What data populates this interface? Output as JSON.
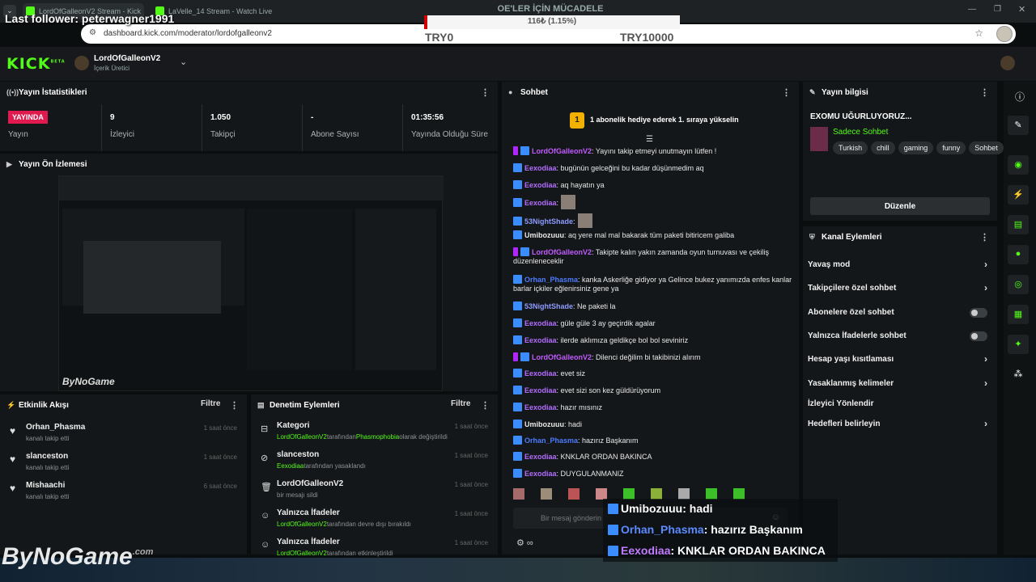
{
  "browser": {
    "tabs": [
      "LordOfGalleonV2 Stream - Kick",
      "LaVelle_14 Stream - Watch Live"
    ],
    "url": "dashboard.kick.com/moderator/lordofgalleonv2"
  },
  "overlay": {
    "last_follower": "Last follower: peterwagner1991",
    "goal_title": "OE'LER İÇİN MÜCADELE",
    "goal_value": "116₺ (1.15%)",
    "goal_progress": 0.0115,
    "goal_min": "TRY0",
    "goal_max": "TRY10000",
    "watermark": "ByNoGame",
    "watermark_suffix": ".com"
  },
  "nav": {
    "logo": "KICK",
    "logo_sup": "BETA",
    "channel_name": "LordOfGalleonV2",
    "channel_role": "İçerik Üretici"
  },
  "stats": {
    "title": "Yayın İstatistikleri",
    "live_badge": "YAYINDA",
    "items": [
      {
        "value": "",
        "label": "Yayın"
      },
      {
        "value": "9",
        "label": "İzleyici"
      },
      {
        "value": "1.050",
        "label": "Takipçi"
      },
      {
        "value": "-",
        "label": "Abone Sayısı"
      },
      {
        "value": "01:35:56",
        "label": "Yayında Olduğu Süre"
      }
    ]
  },
  "preview": {
    "title": "Yayın Ön İzlemesi"
  },
  "activity": {
    "title": "Etkinlik Akışı",
    "filter": "Filtre",
    "events": [
      {
        "name": "Orhan_Phasma",
        "sub": "kanalı takip etti",
        "time": "1 saat önce"
      },
      {
        "name": "slanceston",
        "sub": "kanalı takip etti",
        "time": "1 saat önce"
      },
      {
        "name": "Mishaachi",
        "sub": "kanalı takip etti",
        "time": "6 saat önce"
      }
    ]
  },
  "moderation": {
    "title": "Denetim Eylemleri",
    "filter": "Filtre",
    "actions": [
      {
        "name": "Kategori",
        "actor": "LordOfGalleonV2",
        "middle": "tarafından",
        "target": "Phasmophobia",
        "rest": "olarak değiştirildi",
        "time": "1 saat önce"
      },
      {
        "name": "slanceston",
        "actor": "Eexodiaa",
        "middle": "tarafından yasaklandı",
        "target": "",
        "rest": "",
        "time": "1 saat önce"
      },
      {
        "name": "LordOfGalleonV2",
        "actor": "",
        "middle": "bir mesajı sildi",
        "target": "",
        "rest": "",
        "time": "1 saat önce"
      },
      {
        "name": "Yalnızca İfadeler",
        "actor": "LordOfGalleonV2",
        "middle": "tarafından devre dışı bırakıldı",
        "target": "",
        "rest": "",
        "time": "1 saat önce"
      },
      {
        "name": "Yalnızca İfadeler",
        "actor": "LordOfGalleonV2",
        "middle": "tarafından etkinleştirildi",
        "target": "",
        "rest": "",
        "time": "1 saat önce"
      }
    ]
  },
  "chat": {
    "title": "Sohbet",
    "pinned_rank": "1",
    "pinned": "1 abonelik hediye ederek 1. sıraya yükselin",
    "placeholder": "Bir mesaj gönderin",
    "messages": [
      {
        "user": "LordOfGalleonV2",
        "color": "#c25bff",
        "text": ": Yayını takip etmeyi unutmayın lütfen !",
        "mod": true
      },
      {
        "user": "Eexodiaa",
        "color": "#b36cff",
        "text": ": bugünün gelceğini bu kadar düşünmedim aq",
        "mod": false
      },
      {
        "user": "Eexodiaa",
        "color": "#b36cff",
        "text": ": aq hayatın ya",
        "mod": false
      },
      {
        "user": "Eexodiaa",
        "color": "#b36cff",
        "text": ":",
        "mod": false
      },
      {
        "user": "53NightShade",
        "color": "#8e9bff",
        "text": ":",
        "mod": false
      },
      {
        "user": "Umibozuuu",
        "color": "#e8e8e8",
        "text": ": aq yere mal mal bakarak tüm paketi bitiricem galiba",
        "mod": false
      },
      {
        "user": "LordOfGalleonV2",
        "color": "#c25bff",
        "text": ": Takipte kalın yakın zamanda oyun turnuvası ve çekiliş düzenleneceklir",
        "mod": true
      },
      {
        "user": "Orhan_Phasma",
        "color": "#4e7bff",
        "text": ": kanka Askerliğe gidiyor ya Gelince bukez yanımızda enfes kanlar barlar içkiler eğlenirsiniz gene ya",
        "mod": false
      },
      {
        "user": "53NightShade",
        "color": "#8e9bff",
        "text": ": Ne paketi la",
        "mod": false
      },
      {
        "user": "Eexodiaa",
        "color": "#b36cff",
        "text": ": güle güle 3 ay geçirdik agalar",
        "mod": false
      },
      {
        "user": "Eexodiaa",
        "color": "#b36cff",
        "text": ": ilerde aklımıza geldikçe bol bol seviniriz",
        "mod": false
      },
      {
        "user": "LordOfGalleonV2",
        "color": "#c25bff",
        "text": ": Dilenci değilim bi takibinizi alırım",
        "mod": true
      },
      {
        "user": "Eexodiaa",
        "color": "#b36cff",
        "text": ": evet siz",
        "mod": false
      },
      {
        "user": "Eexodiaa",
        "color": "#b36cff",
        "text": ": evet sizi son kez güldürüyorum",
        "mod": false
      },
      {
        "user": "Eexodiaa",
        "color": "#b36cff",
        "text": ": hazır mısınız",
        "mod": false
      },
      {
        "user": "Umibozuuu",
        "color": "#e8e8e8",
        "text": ": hadi",
        "mod": false
      },
      {
        "user": "Orhan_Phasma",
        "color": "#4e7bff",
        "text": ": hazırız Başkanım",
        "mod": false
      },
      {
        "user": "Eexodiaa",
        "color": "#b36cff",
        "text": ": KNKLAR ORDAN BAKINCA",
        "mod": false
      },
      {
        "user": "Eexodiaa",
        "color": "#b36cff",
        "text": ": DUYGULANMANIZ",
        "mod": false
      }
    ]
  },
  "stream_info": {
    "title": "Yayın bilgisi",
    "stream_title": "EXOMU UĞURLUYORUZ...",
    "category": "Sadece Sohbet",
    "tags": [
      "Turkish",
      "chill",
      "gaming",
      "funny",
      "Sohbet"
    ],
    "edit_label": "Düzenle"
  },
  "channel_actions": {
    "title": "Kanal Eylemleri",
    "items": [
      {
        "label": "Yavaş mod",
        "type": "chevron"
      },
      {
        "label": "Takipçilere özel sohbet",
        "type": "chevron"
      },
      {
        "label": "Abonelere özel sohbet",
        "type": "toggle"
      },
      {
        "label": "Yalnızca İfadelerle sohbet",
        "type": "toggle"
      },
      {
        "label": "Hesap yaşı kısıtlaması",
        "type": "chevron"
      },
      {
        "label": "Yasaklanmış kelimeler",
        "type": "chevron"
      },
      {
        "label": "İzleyici Yönlendir",
        "type": "none"
      },
      {
        "label": "Hedefleri belirleyin",
        "type": "chevron"
      }
    ]
  },
  "overlay_chat": [
    {
      "user": "Umibozuuu",
      "color": "#ffffff",
      "text": ": hadi"
    },
    {
      "user": "Orhan_Phasma",
      "color": "#5b8bff",
      "text": ": hazırız Başkanım"
    },
    {
      "user": "Eexodiaa",
      "color": "#c07bff",
      "text": ": KNKLAR ORDAN BAKINCA"
    }
  ],
  "colors": {
    "accent": "#53fc18",
    "live": "#e0194f",
    "bg": "#0b0e0f",
    "panel": "#141719"
  }
}
